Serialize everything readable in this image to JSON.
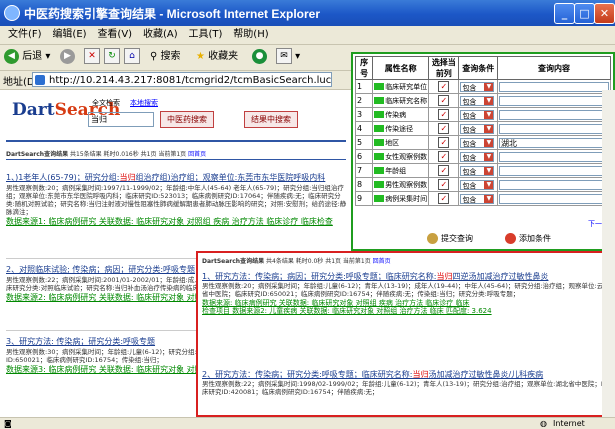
{
  "window": {
    "title": "中医药搜索引擎查询结果 - Microsoft Internet Explorer"
  },
  "menu": [
    "文件(F)",
    "编辑(E)",
    "查看(V)",
    "收藏(A)",
    "工具(T)",
    "帮助(H)"
  ],
  "toolbar": {
    "back": "后退",
    "search": "搜索",
    "favorites": "收藏夹"
  },
  "address": {
    "label": "地址(D)",
    "url": "http://10.214.43.217:8081/tcmgrid2/tcmBasicSearch.luc"
  },
  "search": {
    "logo_a": "Dart",
    "logo_b": "Search",
    "label": "全文检索",
    "link": "本地搜索",
    "query": "当归",
    "btn1": "中医药搜索",
    "btn2": "结果中搜索"
  },
  "stat1": {
    "prefix": "DartSearch查询结果",
    "text": "共15条结果  耗时0.016秒  共1页  当前第1页",
    "link": "回首页"
  },
  "results": [
    {
      "title_pre": "1、)1老年人(65-79)；研究分组:",
      "title_red": "当归",
      "title_post": "组治疗组)治疗组；观察单位:东莞市东华医院呼吸内科",
      "body": "男性观察例数:20；病例采集时间:1997/11-1999/02；年龄组:中年人(45-64) 老年人(65-79)；研究分组:当归组治疗组；观察单位:东莞市东华医院呼吸内科；临床研究ID:523013；临床病例研究ID:17064；伴随疾病:无；临床研究分类:随机对照试验；研究名称:当归注射液对慢性阻塞性肺病缓解期患者肺动脉压影响的研究；对照:安慰剂；给药途径:静脉滴注；",
      "links": "数据来源1: 临床病例研究   关联数据: 临床研究对象  对照组  疾病  治疗方法  临床诊疗  临床检查"
    },
    {
      "title_pre": "2、对照临床试验; 传染病；病因；研究分类:呼吸专题",
      "title_red": "",
      "title_post": "",
      "body": "男性观察例数:22；病例采集时间:2001/01-2002/01；年龄组:成人；研究分组:治疗组；观察单位:浙江省中医院；临床研究分类:对照临床试验；研究名称:当归补血汤治疗传染病的临床研究；伴随疾病:无；",
      "links": "数据来源2: 临床病例研究   关联数据: 临床研究对象  对照组  疾病"
    },
    {
      "title_pre": "3、研究方法: 传染病；研究分类:呼吸专题",
      "title_red": "",
      "title_post": "",
      "body": "男性观察例数:30；病例采集时间；年龄组:儿童(6-12)；研究分组:治疗组；观察单位:云南省中医院；临床研究ID:650021；临床病例研究ID:16754；传染组:当归；",
      "links": "数据来源3: 临床病例研究   关联数据: 临床研究对象  对照组"
    }
  ],
  "dialog": {
    "headers": [
      "序号",
      "属性名称",
      "选择当前列",
      "查询条件",
      "查询内容"
    ],
    "rows": [
      {
        "no": "1",
        "field": "临床研究单位",
        "cond": "包含",
        "val": ""
      },
      {
        "no": "2",
        "field": "临床研究名称",
        "cond": "包含",
        "val": ""
      },
      {
        "no": "3",
        "field": "传染病",
        "cond": "包含",
        "val": ""
      },
      {
        "no": "4",
        "field": "传染途径",
        "cond": "包含",
        "val": ""
      },
      {
        "no": "5",
        "field": "地区",
        "cond": "包含",
        "val": "湖北"
      },
      {
        "no": "6",
        "field": "女性观察例数",
        "cond": "包含",
        "val": ""
      },
      {
        "no": "7",
        "field": "年龄组",
        "cond": "包含",
        "val": ""
      },
      {
        "no": "8",
        "field": "男性观察例数",
        "cond": "包含",
        "val": ""
      },
      {
        "no": "9",
        "field": "病例采集时间",
        "cond": "包含",
        "val": ""
      }
    ],
    "next": "下一页",
    "submit": "提交查询",
    "add": "添加条件"
  },
  "panel2": {
    "stat_prefix": "DartSearch查询结果",
    "stat_text": "共4条结果  耗时0.0秒  共1页  当前第1页",
    "stat_link": "回首页",
    "results": [
      {
        "title_pre": "1、研究方法：传染病；病因；研究分类:呼吸专题；临床研究名称:",
        "title_red": "当归",
        "title_post": "四逆汤加减治疗过敏性鼻炎",
        "body": "男性观察例数:20；病例采集时间；年龄组:儿童(6-12)；青年人(13-19)；成年人(19-44)；中年人(45-64)；研究分组:治疗组；观察单位:云南省中医院；临床研究ID:650021；临床病例研究ID:16754；伴随疾病:无；传染组:当归；研究分类:呼吸专题；",
        "links1": "数据来源: 临床病例研究   关联数据: 临床研究对象  对照组  疾病  治疗方法  临床诊疗  临床",
        "links2": "检查项目  数据来源2: 儿童疾病   关联数据: 临床研究对象  对照组  治疗方法  临床  匹配度: 3.624"
      },
      {
        "title_pre": "2、研究方法：传染病；研究分类:呼吸专题；临床研究名称:",
        "title_red": "当归",
        "title_post": "汤加减治疗过敏性鼻炎/儿科疾病",
        "body": "男性观察例数:22；病例采集时间:1998/02-1999/02；年龄组:儿童(6-12)；青年人(13-19)；研究分组:治疗组；观察单位:湖北省中医院；临床研究ID:420081；临床病例研究ID:16754；伴随疾病:无；",
        "links1": "",
        "links2": ""
      }
    ]
  },
  "status": {
    "zone": "Internet"
  }
}
